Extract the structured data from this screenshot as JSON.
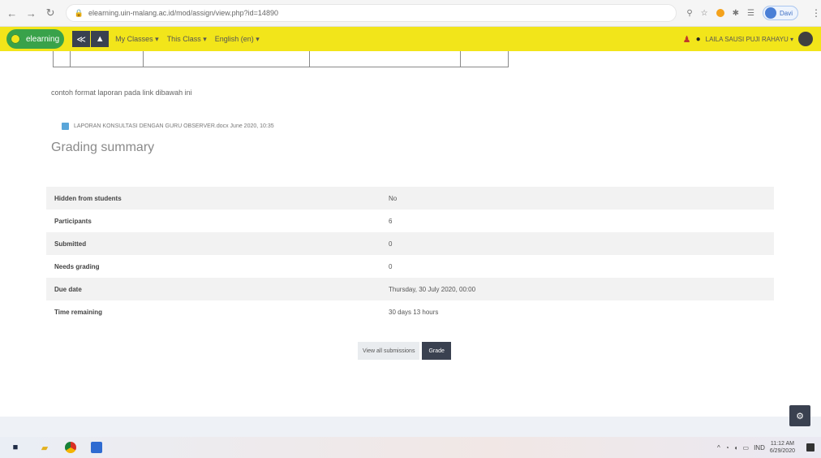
{
  "browser": {
    "url": "elearning.uin-malang.ac.id/mod/assign/view.php?id=14890",
    "profile_label": "Davi"
  },
  "navbar": {
    "brand": "elearning",
    "menu": [
      "My Classes ▾",
      "This Class ▾",
      "English (en) ▾"
    ],
    "user_name": "LAILA SAUSI PUJI RAHAYU ▾"
  },
  "content": {
    "note": "contoh format laporan pada link dibawah ini",
    "attachment": "LAPORAN KONSULTASI DENGAN GURU OBSERVER.docx  June 2020, 10:35",
    "section_title": "Grading summary",
    "grading_rows": [
      {
        "label": "Hidden from students",
        "value": "No"
      },
      {
        "label": "Participants",
        "value": "6"
      },
      {
        "label": "Submitted",
        "value": "0"
      },
      {
        "label": "Needs grading",
        "value": "0"
      },
      {
        "label": "Due date",
        "value": "Thursday, 30 July 2020, 00:00"
      },
      {
        "label": "Time remaining",
        "value": "30 days 13 hours"
      }
    ],
    "buttons": {
      "view_all": "View all submissions",
      "grade": "Grade"
    }
  },
  "taskbar": {
    "tray_lang": "IND",
    "time": "11:12 AM",
    "date": "6/29/2020"
  },
  "colors": {
    "navbar": "#f2e51a",
    "brand_green": "#39a24a",
    "primary_button": "#3a4150"
  }
}
